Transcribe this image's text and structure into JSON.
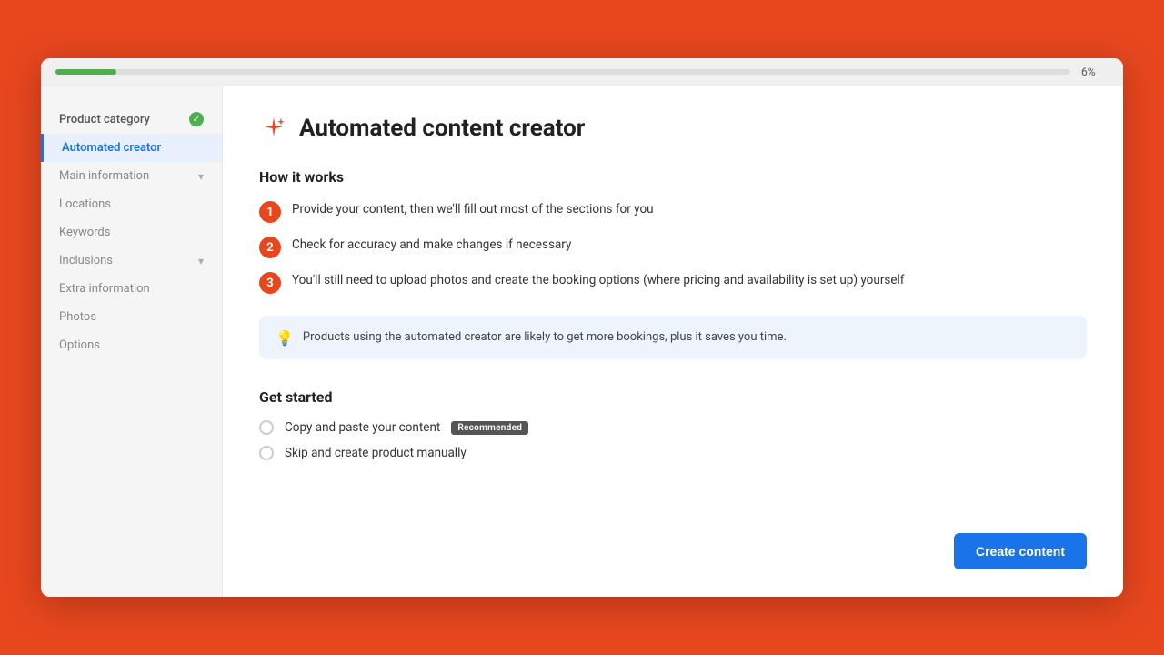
{
  "browser": {
    "progress_percent": "6%",
    "progress_width": "6%"
  },
  "sidebar": {
    "product_category": "Product category",
    "automated_creator": "Automated creator",
    "main_information": "Main information",
    "locations": "Locations",
    "keywords": "Keywords",
    "inclusions": "Inclusions",
    "extra_information": "Extra information",
    "photos": "Photos",
    "options": "Options"
  },
  "main": {
    "page_title": "Automated content creator",
    "how_it_works_heading": "How it works",
    "steps": [
      {
        "number": "1",
        "text": "Provide your content, then we'll fill out most of the sections for you"
      },
      {
        "number": "2",
        "text": "Check for accuracy and make changes if necessary"
      },
      {
        "number": "3",
        "text": "You'll still need to upload photos and create the booking options (where pricing and availability is set up) yourself"
      }
    ],
    "info_text": "Products using the automated creator are likely to get more bookings, plus it saves you time.",
    "get_started_heading": "Get started",
    "option_copy_paste": "Copy and paste your content",
    "recommended_label": "Recommended",
    "option_skip": "Skip and create product manually",
    "create_button": "Create content"
  }
}
